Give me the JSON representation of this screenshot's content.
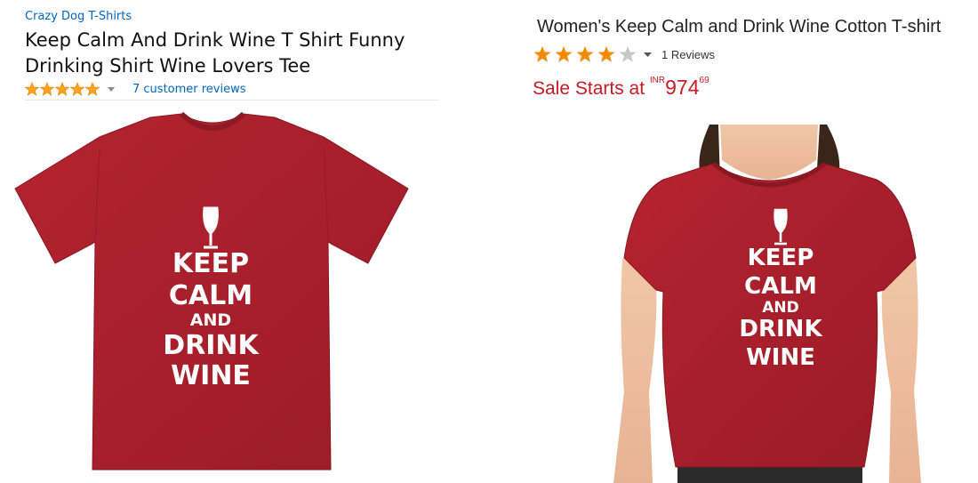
{
  "left_product": {
    "brand": "Crazy Dog T-Shirts",
    "title": "Keep Calm And Drink Wine T Shirt Funny Drinking Shirt Wine Lovers Tee",
    "rating_stars": 5,
    "reviews_link": "7 customer reviews",
    "shirt_text": [
      "KEEP",
      "CALM",
      "AND",
      "DRINK",
      "WINE"
    ]
  },
  "right_product": {
    "title": "Women's Keep Calm and Drink Wine Cotton T-shirt",
    "rating_stars": 4,
    "reviews_count": "1 Reviews",
    "sale_label": "Sale Starts at",
    "currency": "INR",
    "price_whole": "974",
    "price_fraction": "69",
    "shirt_text": [
      "KEEP",
      "CALM",
      "AND",
      "DRINK",
      "WINE"
    ]
  },
  "colors": {
    "link_blue": "#0066c0",
    "amazon_star": "#ffa41c",
    "rating_star": "#f28a00",
    "star_empty": "#c8c8c8",
    "sale_red": "#c61a24",
    "shirt_red": "#a8202c"
  }
}
